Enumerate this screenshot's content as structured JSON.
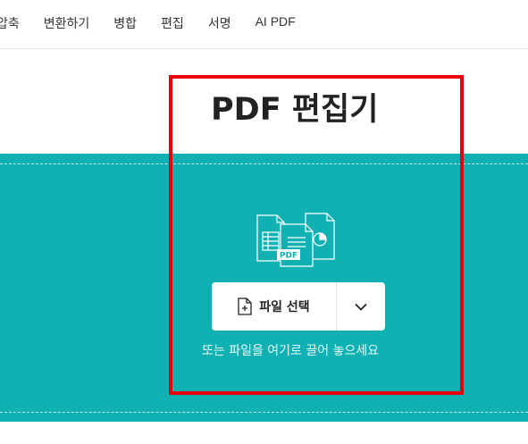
{
  "nav": {
    "items": [
      "압축",
      "변환하기",
      "병합",
      "편집",
      "서명",
      "AI PDF"
    ]
  },
  "page": {
    "title": "PDF 편집기"
  },
  "upload": {
    "illustration_badge": "PDF",
    "select_button_label": "파일 선택",
    "drop_hint": "또는 파일을 여기로 끌어 놓으세요"
  },
  "icons": {
    "select_button": "add-file-icon",
    "dropdown": "chevron-down-icon",
    "illustration": "documents-illustration-icon"
  },
  "colors": {
    "dropzone_bg": "#11b1b3",
    "highlight_border": "#e8000a",
    "button_bg": "#ffffff"
  }
}
